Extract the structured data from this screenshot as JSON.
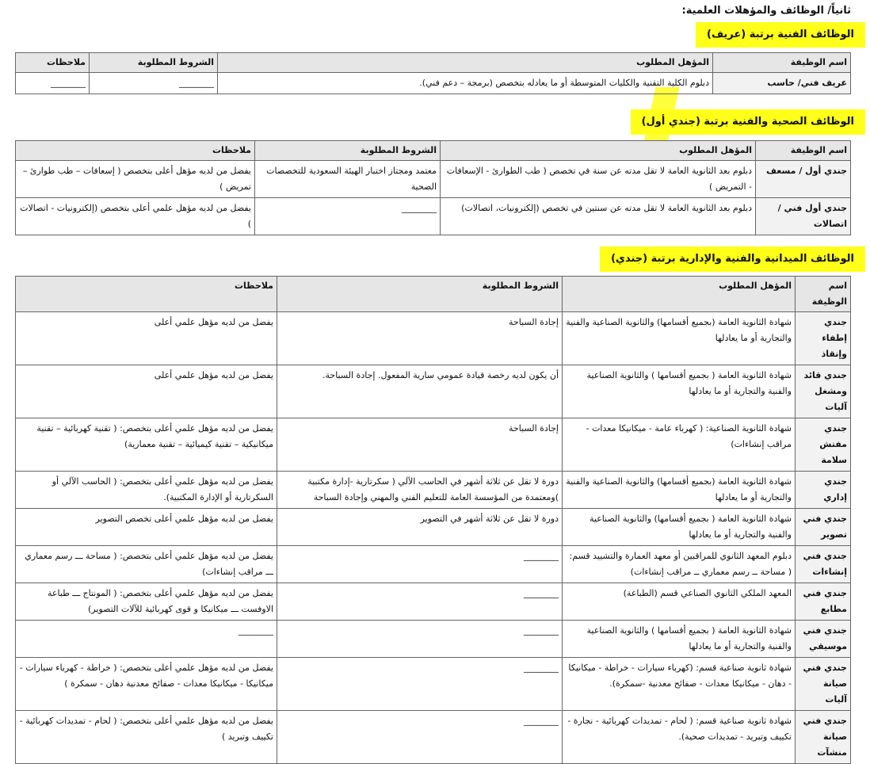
{
  "page_heading": "ثانياً/ الوظائف والمؤهلات العلمية:",
  "sections": [
    {
      "title": "الوظائف الفنية برتبة (عريف)",
      "headers": [
        "اسم الوظيفة",
        "المؤهل المطلوب",
        "الشروط المطلوبة",
        "ملاحظات"
      ],
      "rows": [
        [
          "عريف فني/ حاسب",
          "دبلوم الكلية التقنية والكليات المتوسطة أو ما يعادله بتخصص (برمجة – دعم فني).",
          "________",
          "________"
        ]
      ]
    },
    {
      "title": "الوظائف الصحية والفنية برتبة (جندي أول)",
      "headers": [
        "اسم الوظيفة",
        "المؤهل المطلوب",
        "الشروط المطلوبة",
        "ملاحظات"
      ],
      "rows": [
        [
          "جندي أول / مسعف",
          "دبلوم بعد الثانوية العامة لا تقل مدته عن سنة في تخصص ( طب الطوارئ - الإسعافات - التمريض )",
          "معتمد ومجتاز اختبار الهيئة السعودية للتخصصات الصحية",
          "يفضل من لديه مؤهل أعلى بتخصص ( إسعافات – طب طوارئ – تمريض )"
        ],
        [
          "جندي أول فني / اتصالات",
          "دبلوم بعد الثانوية العامة لا تقل مدته عن سنتين في تخصص (إلكترونيات، اتصالات)",
          "________",
          "يفضل من لديه مؤهل علمي أعلى بتخصص (إلكترونيات - اتصالات )"
        ]
      ]
    },
    {
      "title": "الوظائف الميدانية والفنية والإدارية برتبة (جندي)",
      "headers": [
        "اسم الوظيفة",
        "المؤهل المطلوب",
        "الشروط المطلوبة",
        "ملاحظات"
      ],
      "rows": [
        [
          "جندي إطفاء وإنقاذ",
          "شهادة الثانوية العامة (بجميع أقسامها) والثانوية الصناعية والفنية والتجارية أو ما يعادلها",
          "إجادة السباحة",
          "يفضل من لديه مؤهل علمي أعلى"
        ],
        [
          "جندي قائد ومشغل آليات",
          "شهادة الثانوية العامة ( بجميع أقسامها ) والثانوية الصناعية والفنية والتجارية أو ما يعادلها",
          "أن يكون لديه رخصة قيادة عمومي سارية المفعول. إجادة السباحة.",
          "يفضل من لديه مؤهل علمي أعلى"
        ],
        [
          "جندي مفتش سلامة",
          "شهادة الثانوية الصناعية: ( كهرباء عامة - ميكانيكا معدات - مراقب إنشاءات)",
          "إجادة السباحة",
          "يفضل من لديه مؤهل علمي أعلى بتخصص: ( تقنية كهربائية – تقنية ميكانيكية – تقنية كيميائية – تقنية معمارية)"
        ],
        [
          "جندي إداري",
          "شهادة الثانوية العامة (بجميع أقسامها) والثانوية الصناعية والفنية والتجارية أو ما يعادلها",
          "دورة لا تقل عن ثلاثة أشهر في الحاسب الآلي ( سكرتارية -إدارة مكتبية )ومعتمدة من المؤسسة العامة للتعليم الفني والمهني وإجادة السباحة",
          "يفضل من لديه مؤهل علمي أعلى بتخصص: ( الحاسب الآلي أو السكرتارية أو الإدارة المكتبية)."
        ],
        [
          "جندي فني تصوير",
          "شهادة الثانوية العامة ( بجميع أقسامها) والثانوية الصناعية والفنية والتجارية أو ما يعادلها",
          "دورة لا تقل عن ثلاثة أشهر في التصوير",
          "يفضل من لديه مؤهل علمي أعلى تخصص التصوير"
        ],
        [
          "جندي فني إنشاءات",
          "دبلوم المعهد الثانوي للمراقبين أو معهد العمارة والتشييد قسم: ( مساحة ــ رسم معماري ــ مراقب إنشاءات)",
          "________",
          "يفضل من لديه مؤهل علمي أعلى بتخصص: ( مساحة ـــ رسم معماري ـــ مراقب إنشاءات)"
        ],
        [
          "جندي فني مطابع",
          "المعهد الملكي الثانوي الصناعي قسم (الطباعة)",
          "________",
          "يفضل من لديه مؤهل علمي أعلى بتخصص: ( المونتاج ـــ طباعة الاوفست ـــ ميكانيكا و قوى كهربائية للآلات التصوير)"
        ],
        [
          "جندي فني موسيقي",
          "شهادة الثانوية العامة ( بجميع أقسامها ) والثانوية الصناعية والفنية والتجارية أو ما يعادلها",
          "________",
          "________"
        ],
        [
          "جندي فني صيانة آليات",
          "شهادة ثانوية صناعية قسم: (كهرباء سيارات - خراطة - ميكانيكا - دهان - ميكانيكا معدات - صفائح معدنية -سمكرة).",
          "________",
          "يفضل من لديه مؤهل علمي أعلى بتخصص: ( خراطة - كهرباء سيارات - ميكانيكا - ميكانيكا معدات - صفائح معدنية دهان - سمكرة )"
        ],
        [
          "جندي فني صيانة منشآت",
          "شهادة ثانوية صناعية قسم: ( لحام - تمديدات كهربائية - نجارة - تكييف وتبريد - تمديدات صحية).",
          "________",
          "يفضل من لديه مؤهل علمي أعلى بتخصص: ( لحام - تمديدات كهربائية - تكييف وتبريد )"
        ]
      ]
    }
  ]
}
